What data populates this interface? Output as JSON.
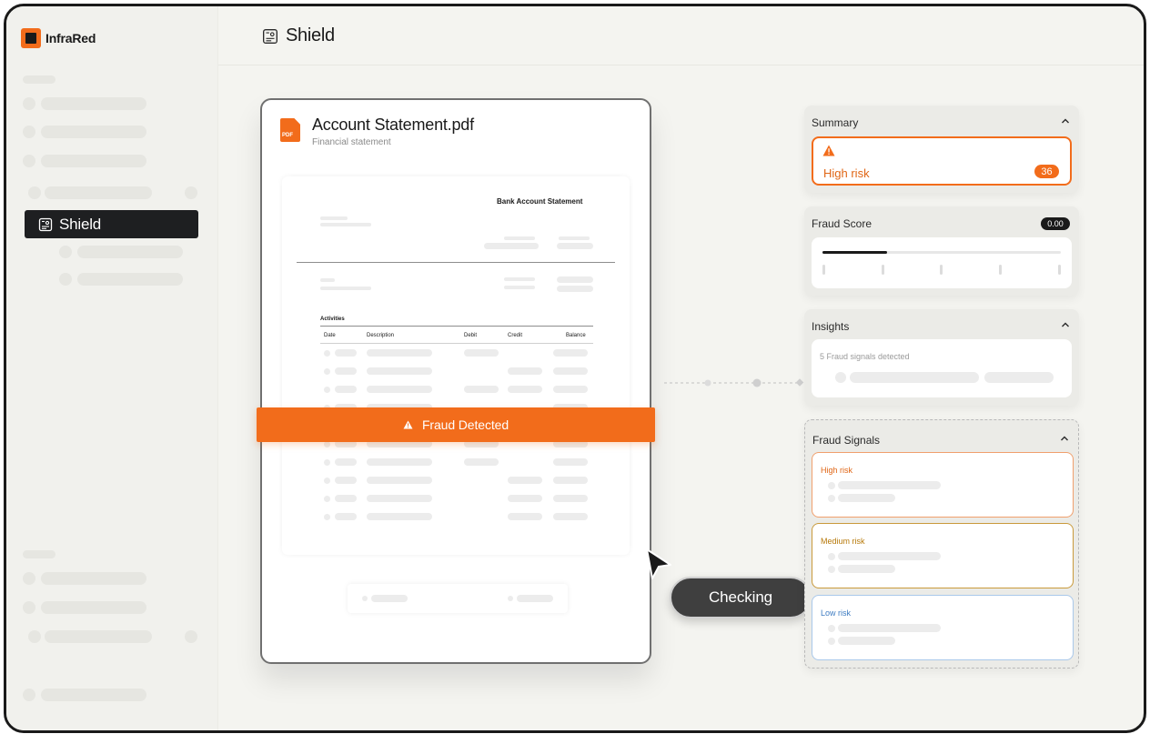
{
  "app": {
    "name": "InfraRed"
  },
  "sidebar": {
    "active_item": "Shield"
  },
  "header": {
    "title": "Shield"
  },
  "document": {
    "file_name": "Account Statement.pdf",
    "file_type": "Financial statement",
    "pdf_badge": "PDF",
    "statement_title": "Bank Account Statement",
    "activities_label": "Activities",
    "columns": [
      "Date",
      "Description",
      "Debit",
      "Credit",
      "Balance"
    ]
  },
  "banner": {
    "label": "Fraud Detected"
  },
  "status": {
    "checking": "Checking"
  },
  "summary": {
    "title": "Summary",
    "risk_label": "High risk",
    "risk_count": "36"
  },
  "fraud_score": {
    "title": "Fraud Score",
    "value": "0.00",
    "progress": 0.27
  },
  "insights": {
    "title": "Insights",
    "text": "5 Fraud signals detected"
  },
  "fraud_signals": {
    "title": "Fraud Signals",
    "high": "High risk",
    "medium": "Medium risk",
    "low": "Low risk"
  },
  "colors": {
    "accent": "#f26c1b",
    "high_risk": "#e06616",
    "medium_risk": "#b7790a",
    "low_risk": "#3e7cc2"
  }
}
